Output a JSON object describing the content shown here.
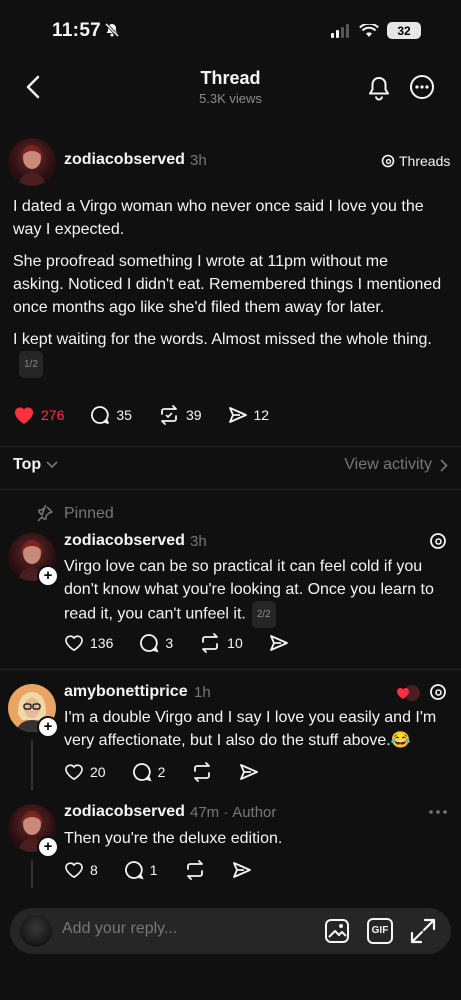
{
  "status_bar": {
    "time": "11:57",
    "battery": "32"
  },
  "header": {
    "title": "Thread",
    "views": "5.3K views"
  },
  "post": {
    "username": "zodiacobserved",
    "time": "3h",
    "source": "Threads",
    "paragraphs": [
      "I dated a Virgo woman who never once said I love you the way I expected.",
      "She proofread something I wrote at 11pm without me asking. Noticed I didn't eat. Remembered things I mentioned once months ago like she'd filed them away for later.",
      "I kept waiting for the words. Almost missed the whole thing."
    ],
    "pager": "1/2",
    "likes": "276",
    "replies": "35",
    "reposts": "39",
    "shares": "12"
  },
  "sort": {
    "label": "Top",
    "view_activity": "View activity"
  },
  "pinned_label": "Pinned",
  "comments": [
    {
      "username": "zodiacobserved",
      "time": "3h",
      "text": "Virgo love can be so practical it can feel cold if you don't know what you're looking at. Once you learn to read it, you can't unfeel it.",
      "pager": "2/2",
      "likes": "136",
      "replies": "3",
      "reposts": "10"
    },
    {
      "username": "amybonettiprice",
      "time": "1h",
      "text": "I'm a double Virgo and I say I love you easily and I'm very affectionate, but I also do the stuff above.😂",
      "likes": "20",
      "replies": "2"
    },
    {
      "username": "zodiacobserved",
      "time": "47m",
      "author_tag": "Author",
      "text": "Then you're the deluxe edition.",
      "likes": "8",
      "replies": "1"
    }
  ],
  "reply_bar": {
    "placeholder": "Add your reply...",
    "gif_label": "GIF"
  },
  "colors": {
    "background": "#101010",
    "like_red": "#ff3040",
    "muted": "#777777"
  }
}
